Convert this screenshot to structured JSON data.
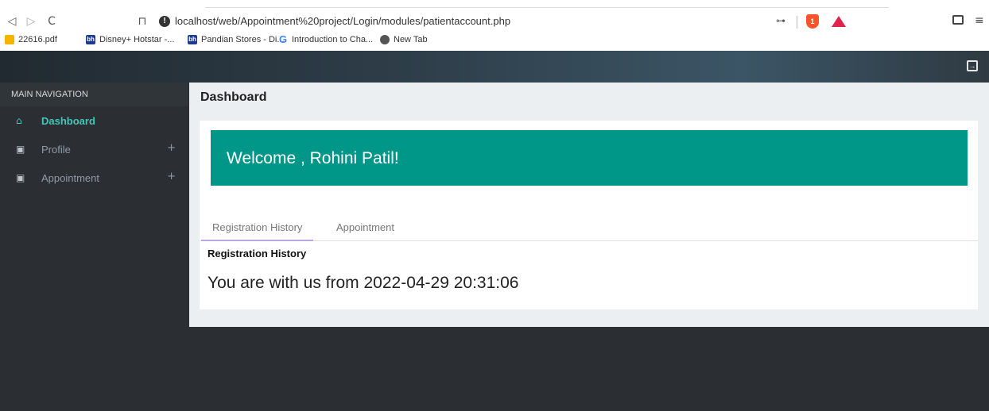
{
  "browser": {
    "url": "localhost/web/Appointment%20project/Login/modules/patientaccount.php",
    "nav_back": "◁",
    "nav_forward": "▷",
    "nav_reload": "C",
    "bookmark_glyph": "⊓",
    "info_glyph": "!",
    "bookmarks": [
      {
        "label": "22616.pdf",
        "icon": "drive-icon",
        "color": "#f4b400"
      },
      {
        "label": "Disney+ Hotstar -...",
        "icon": "bh-icon",
        "color": "#1a3c8f"
      },
      {
        "label": "Pandian Stores - Di...",
        "icon": "bh-icon",
        "color": "#1a3c8f"
      },
      {
        "label": "Introduction to Cha...",
        "icon": "g-icon",
        "color": "#4285f4"
      },
      {
        "label": "New Tab",
        "icon": "globe-icon",
        "color": "#555555"
      }
    ]
  },
  "sidebar": {
    "title": "MAIN NAVIGATION",
    "items": [
      {
        "label": "Dashboard",
        "icon": "home-icon",
        "active": true
      },
      {
        "label": "Profile",
        "icon": "calendar-check-icon",
        "plus": "+"
      },
      {
        "label": "Appointment",
        "icon": "calendar-check-icon",
        "plus": "+"
      }
    ]
  },
  "main": {
    "title": "Dashboard",
    "welcome": "Welcome , Rohini Patil!",
    "tabs": [
      {
        "label": "Registration History",
        "active": true
      },
      {
        "label": "Appointment",
        "active": false
      }
    ],
    "section_title": "Registration History",
    "history_text": "You are with us from 2022-04-29 20:31:06"
  },
  "colors": {
    "accent": "#009688",
    "active_nav": "#3fc7b7",
    "sidebar_bg": "#2b2f33"
  }
}
